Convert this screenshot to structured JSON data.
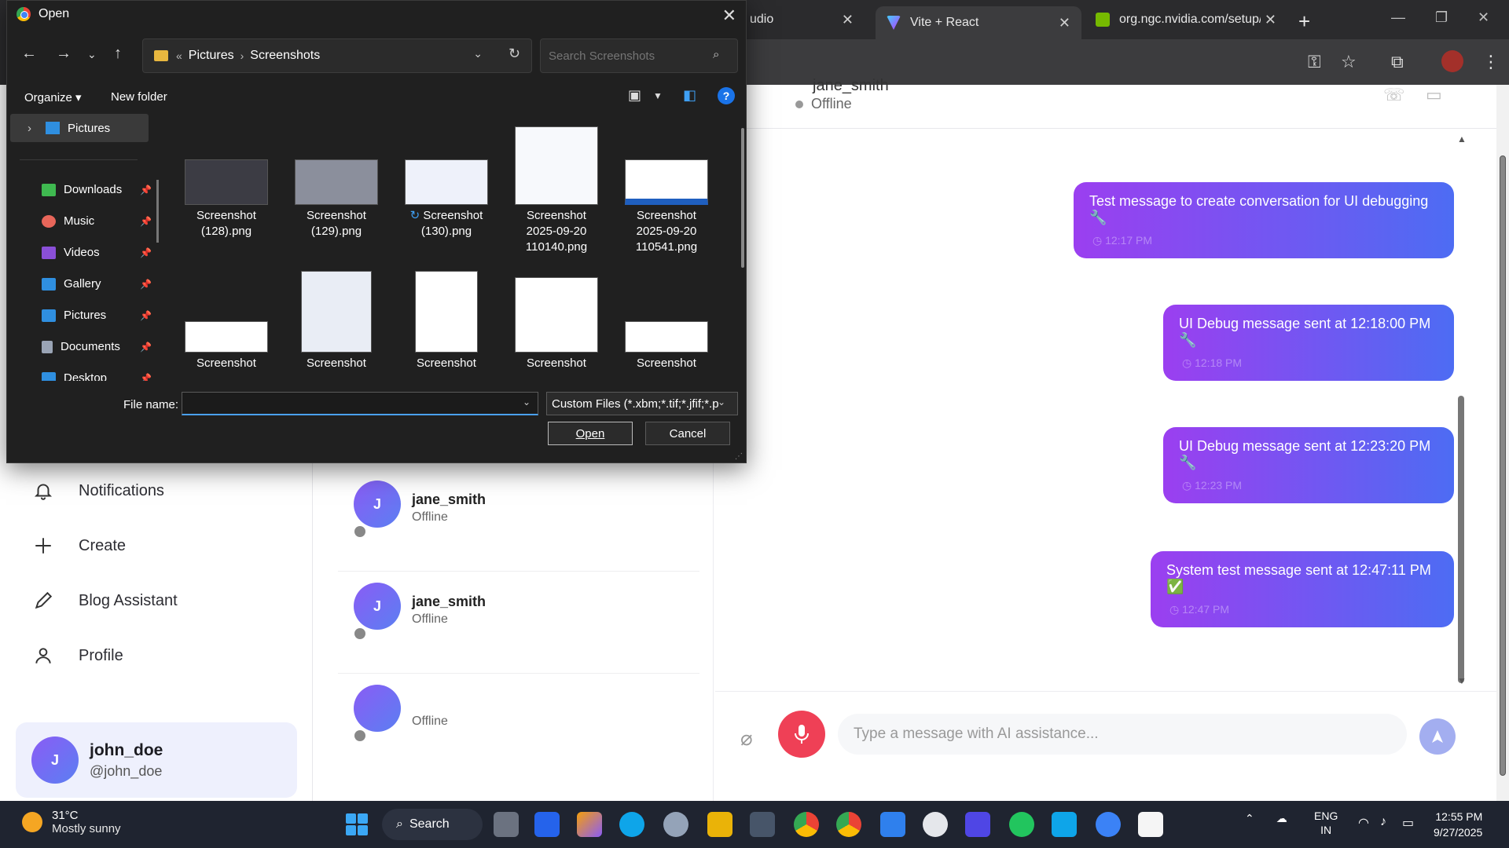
{
  "browser": {
    "tabs": [
      {
        "label": "udio"
      },
      {
        "label": "Vite + React"
      },
      {
        "label": "org.ngc.nvidia.com/setup/"
      }
    ],
    "close_glyph": "✕",
    "new_tab": "+"
  },
  "dialog": {
    "title": "Open",
    "breadcrumb": {
      "prefix": "«",
      "items": [
        "Pictures",
        "Screenshots"
      ]
    },
    "search_placeholder": "Search Screenshots",
    "toolbar": {
      "organize": "Organize ▾",
      "new_folder": "New folder",
      "help": "?"
    },
    "nav_pane": {
      "root": "Pictures",
      "items": [
        {
          "label": "Downloads",
          "icon": "download-icon",
          "color": "#3fb950"
        },
        {
          "label": "Music",
          "icon": "music-icon",
          "color": "#e8665a"
        },
        {
          "label": "Videos",
          "icon": "video-icon",
          "color": "#8a4fd8"
        },
        {
          "label": "Gallery",
          "icon": "gallery-icon",
          "color": "#2f8fe0"
        },
        {
          "label": "Pictures",
          "icon": "pictures-icon",
          "color": "#2f8fe0"
        },
        {
          "label": "Documents",
          "icon": "documents-icon",
          "color": "#9aa4b5"
        },
        {
          "label": "Desktop",
          "icon": "desktop-icon",
          "color": "#2f8fe0"
        }
      ]
    },
    "files_row1": [
      {
        "line1": "Screenshot",
        "line2": "(128).png",
        "line3": ""
      },
      {
        "line1": "Screenshot",
        "line2": "(129).png",
        "line3": ""
      },
      {
        "line1": "Screenshot",
        "line2": "(130).png",
        "line3": ""
      },
      {
        "line1": "Screenshot",
        "line2": "2025-09-20",
        "line3": "110140.png"
      },
      {
        "line1": "Screenshot",
        "line2": "2025-09-20",
        "line3": "110541.png"
      }
    ],
    "files_row2": [
      {
        "line1": "Screenshot"
      },
      {
        "line1": "Screenshot"
      },
      {
        "line1": "Screenshot"
      },
      {
        "line1": "Screenshot"
      },
      {
        "line1": "Screenshot"
      }
    ],
    "file_name_label": "File name:",
    "file_name_value": "",
    "filter": "Custom Files (*.xbm;*.tif;*.jfif;*.p",
    "open_button": "Open",
    "cancel_button": "Cancel"
  },
  "sidebar": {
    "items": [
      {
        "label": "Notifications",
        "icon": "bell-icon"
      },
      {
        "label": "Create",
        "icon": "plus-icon"
      },
      {
        "label": "Blog Assistant",
        "icon": "pencil-icon"
      },
      {
        "label": "Profile",
        "icon": "user-icon"
      }
    ],
    "user": {
      "initial": "J",
      "name": "john_doe",
      "handle": "@john_doe"
    }
  },
  "conversations": [
    {
      "initial": "J",
      "name": "jane_smith",
      "status": "Offline"
    },
    {
      "initial": "J",
      "name": "jane_smith",
      "status": "Offline"
    },
    {
      "initial": "",
      "name": "",
      "status": "Offline"
    }
  ],
  "chat": {
    "header": {
      "name": "jane_smith",
      "status": "Offline"
    },
    "messages": [
      {
        "text": "Test message to create conversation for UI debugging 🔧",
        "time": "12:17 PM"
      },
      {
        "text": "UI Debug message sent at 12:18:00 PM 🔧",
        "time": "12:18 PM"
      },
      {
        "text": "UI Debug message sent at 12:23:20 PM 🔧",
        "time": "12:23 PM"
      },
      {
        "text": "System test message sent at 12:47:11 PM ✅",
        "time": "12:47 PM"
      }
    ],
    "input_placeholder": "Type a message with AI assistance..."
  },
  "taskbar": {
    "weather": {
      "temp": "31°C",
      "desc": "Mostly sunny"
    },
    "search_label": "Search",
    "lang": {
      "line1": "ENG",
      "line2": "IN"
    },
    "clock": {
      "time": "12:55 PM",
      "date": "9/27/2025"
    }
  },
  "colors": {
    "bubble_start": "#9b3ff0",
    "bubble_end": "#4d6cf3",
    "mic": "#ef4056",
    "accent": "#6a63f0"
  }
}
